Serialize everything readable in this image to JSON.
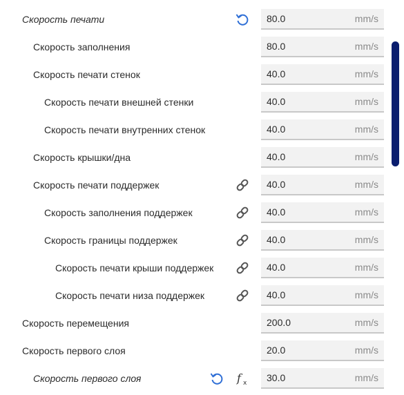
{
  "colors": {
    "accent": "#2f6fd6",
    "text": "#2b2b2b",
    "unit": "#8a8a8a",
    "field_bg": "#f2f2f2",
    "field_border": "#c8c8c8",
    "scrollbar": "#0a1d6e",
    "link_icon": "#555555"
  },
  "settings": [
    {
      "label": "Скорость печати",
      "value": "80.0",
      "unit": "mm/s",
      "italic": true,
      "icons": [
        "reset-icon"
      ]
    },
    {
      "label": "Скорость заполнения",
      "value": "80.0",
      "unit": "mm/s"
    },
    {
      "label": "Скорость печати стенок",
      "value": "40.0",
      "unit": "mm/s"
    },
    {
      "label": "Скорость печати внешней стенки",
      "value": "40.0",
      "unit": "mm/s"
    },
    {
      "label": "Скорость печати внутренних стенок",
      "value": "40.0",
      "unit": "mm/s"
    },
    {
      "label": "Скорость крышки/дна",
      "value": "40.0",
      "unit": "mm/s"
    },
    {
      "label": "Скорость печати поддержек",
      "value": "40.0",
      "unit": "mm/s",
      "icons": [
        "link-icon"
      ]
    },
    {
      "label": "Скорость заполнения поддержек",
      "value": "40.0",
      "unit": "mm/s",
      "icons": [
        "link-icon"
      ]
    },
    {
      "label": "Скорость границы поддержек",
      "value": "40.0",
      "unit": "mm/s",
      "icons": [
        "link-icon"
      ]
    },
    {
      "label": "Скорость печати крыши поддержек",
      "value": "40.0",
      "unit": "mm/s",
      "icons": [
        "link-icon"
      ]
    },
    {
      "label": "Скорость печати низа поддержек",
      "value": "40.0",
      "unit": "mm/s",
      "icons": [
        "link-icon"
      ]
    },
    {
      "label": "Скорость перемещения",
      "value": "200.0",
      "unit": "mm/s"
    },
    {
      "label": "Скорость первого слоя",
      "value": "20.0",
      "unit": "mm/s"
    },
    {
      "label": "Скорость первого слоя",
      "value": "30.0",
      "unit": "mm/s",
      "italic": true,
      "icons": [
        "reset-icon",
        "function-icon"
      ]
    }
  ]
}
